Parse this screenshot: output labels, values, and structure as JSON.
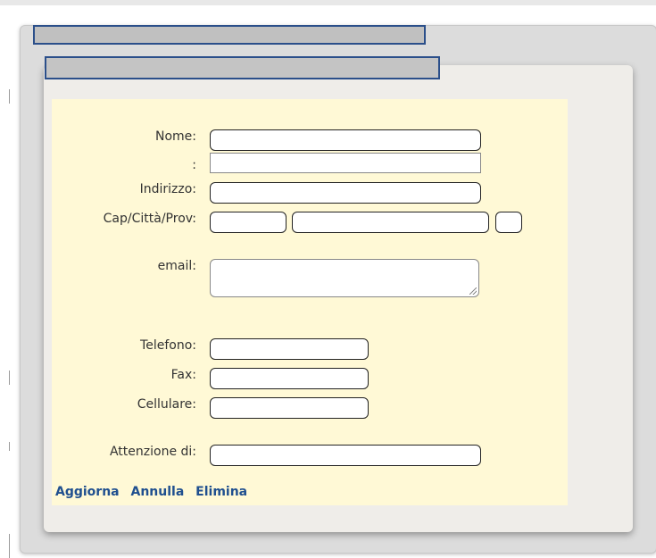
{
  "form": {
    "nome_label": "Nome:",
    "colon_label": ":",
    "indirizzo_label": "Indirizzo:",
    "cap_citta_prov_label": "Cap/Città/Prov:",
    "email_label": "email:",
    "telefono_label": "Telefono:",
    "fax_label": "Fax:",
    "cellulare_label": "Cellulare:",
    "attenzione_label": "Attenzione di:"
  },
  "actions": {
    "aggiorna": "Aggiorna",
    "annulla": "Annulla",
    "elimina": "Elimina"
  }
}
